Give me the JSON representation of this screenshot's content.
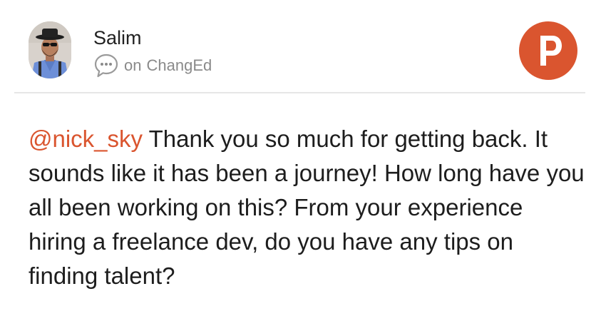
{
  "post": {
    "author": "Salim",
    "context_prefix": "on",
    "product": "ChangEd",
    "mention": "@nick_sky",
    "body": "Thank you so much for getting back. It sounds like it has been a journey! How long have you all been working on this? From your experience hiring a freelance dev, do you have any tips on finding talent?"
  },
  "icons": {
    "avatar": "user-photo",
    "context": "speech-bubble-ellipsis-icon",
    "brand": "product-hunt-logo"
  },
  "colors": {
    "brand": "#da552f",
    "mention": "#da552f",
    "text": "#1d1d1d",
    "muted": "#8a8a8a",
    "divider": "#e6e6e6"
  },
  "brand_letter": "P"
}
